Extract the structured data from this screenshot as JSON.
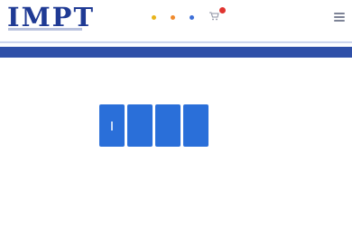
{
  "header": {
    "logo_text": "IMPT",
    "nav": [
      {
        "label": "",
        "icon": "yellow-dot-icon"
      },
      {
        "label": "",
        "icon": "orange-dot-icon"
      },
      {
        "label": "",
        "icon": "blue-dot-icon"
      },
      {
        "label": "",
        "icon": "cart-icon"
      }
    ],
    "menu_icon": "hamburger-menu-icon"
  },
  "verification": {
    "instruction": "",
    "code_digits": [
      "",
      "",
      "",
      ""
    ],
    "resend_text": ""
  },
  "colors": {
    "brand": "#1f3a94",
    "band": "#2f50a8",
    "code_box": "#2a6fd9",
    "badge": "#e0342f"
  }
}
